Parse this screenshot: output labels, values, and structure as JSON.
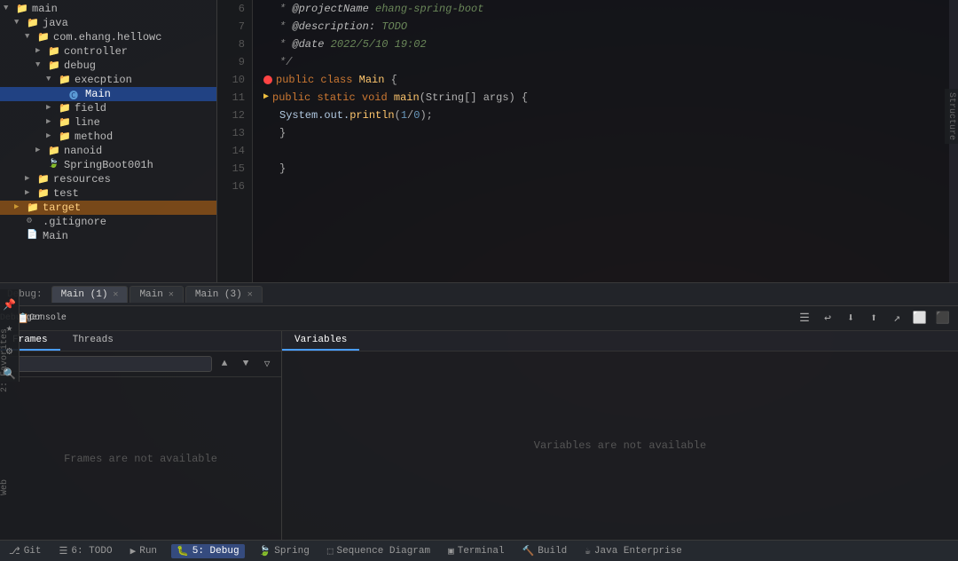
{
  "sidebar": {
    "tree": [
      {
        "id": "main",
        "label": "main",
        "level": 0,
        "type": "folder",
        "expanded": true,
        "icon": "▼"
      },
      {
        "id": "java",
        "label": "java",
        "level": 1,
        "type": "folder",
        "expanded": true,
        "icon": "▼"
      },
      {
        "id": "com.ehang.hellowc",
        "label": "com.ehang.hellowc",
        "level": 2,
        "type": "folder",
        "expanded": true,
        "icon": "▼"
      },
      {
        "id": "controller",
        "label": "controller",
        "level": 3,
        "type": "folder",
        "expanded": false,
        "icon": "▶"
      },
      {
        "id": "debug",
        "label": "debug",
        "level": 3,
        "type": "folder",
        "expanded": true,
        "icon": "▼"
      },
      {
        "id": "exception",
        "label": "execption",
        "level": 4,
        "type": "folder",
        "expanded": true,
        "icon": "▼"
      },
      {
        "id": "Main",
        "label": "Main",
        "level": 5,
        "type": "class",
        "selected": true,
        "icon": "🅒"
      },
      {
        "id": "field",
        "label": "field",
        "level": 4,
        "type": "folder",
        "expanded": false,
        "icon": "▶"
      },
      {
        "id": "line",
        "label": "line",
        "level": 4,
        "type": "folder",
        "expanded": false,
        "icon": "▶"
      },
      {
        "id": "method",
        "label": "method",
        "level": 4,
        "type": "folder",
        "expanded": false,
        "icon": "▶"
      },
      {
        "id": "nanoid",
        "label": "nanoid",
        "level": 3,
        "type": "folder",
        "expanded": false,
        "icon": "▶"
      },
      {
        "id": "SpringBoot001h",
        "label": "SpringBoot001h",
        "level": 3,
        "type": "class"
      },
      {
        "id": "resources",
        "label": "resources",
        "level": 2,
        "type": "folder",
        "expanded": false,
        "icon": "▶"
      },
      {
        "id": "test",
        "label": "test",
        "level": 2,
        "type": "folder",
        "expanded": false,
        "icon": "▶"
      },
      {
        "id": "target",
        "label": "target",
        "level": 1,
        "type": "folder",
        "expanded": false,
        "icon": "▶",
        "highlighted": true
      },
      {
        "id": "gitignore",
        "label": ".gitignore",
        "level": 1,
        "type": "file"
      },
      {
        "id": "pom",
        "label": "Main",
        "level": 1,
        "type": "file"
      }
    ]
  },
  "editor": {
    "lines": [
      {
        "num": 6,
        "tokens": [
          {
            "t": " * ",
            "c": "comment"
          },
          {
            "t": "@projectName ",
            "c": "annotation"
          },
          {
            "t": "ehang-spring-boot",
            "c": "annot-val"
          }
        ]
      },
      {
        "num": 7,
        "tokens": [
          {
            "t": " * ",
            "c": "comment"
          },
          {
            "t": "@description: ",
            "c": "annotation"
          },
          {
            "t": "TODO",
            "c": "annot-val"
          }
        ]
      },
      {
        "num": 8,
        "tokens": [
          {
            "t": " * ",
            "c": "comment"
          },
          {
            "t": "@date ",
            "c": "annotation"
          },
          {
            "t": "2022/5/10 19:02",
            "c": "annot-val"
          }
        ]
      },
      {
        "num": 9,
        "tokens": [
          {
            "t": " */",
            "c": "comment"
          }
        ]
      },
      {
        "num": 10,
        "tokens": [
          {
            "t": "public ",
            "c": "kw"
          },
          {
            "t": "class ",
            "c": "kw"
          },
          {
            "t": "Main ",
            "c": "class-name"
          },
          {
            "t": "{",
            "c": "punc"
          }
        ],
        "breakpoint": true
      },
      {
        "num": 11,
        "tokens": [
          {
            "t": "    public ",
            "c": "kw"
          },
          {
            "t": "static ",
            "c": "kw"
          },
          {
            "t": "void ",
            "c": "kw-void"
          },
          {
            "t": "main",
            "c": "method-name"
          },
          {
            "t": "(String[] args) {",
            "c": "param"
          }
        ],
        "arrow": true
      },
      {
        "num": 12,
        "tokens": [
          {
            "t": "        System.out.",
            "c": "sys-out"
          },
          {
            "t": "println",
            "c": "method-name"
          },
          {
            "t": "(",
            "c": "punc"
          },
          {
            "t": "1",
            "c": "number"
          },
          {
            "t": "/",
            "c": "punc"
          },
          {
            "t": "0",
            "c": "number"
          },
          {
            "t": ");",
            "c": "punc"
          }
        ]
      },
      {
        "num": 13,
        "tokens": [
          {
            "t": "    }",
            "c": "punc"
          }
        ]
      },
      {
        "num": 14,
        "tokens": []
      },
      {
        "num": 15,
        "tokens": [
          {
            "t": "}",
            "c": "punc"
          }
        ]
      },
      {
        "num": 16,
        "tokens": []
      }
    ]
  },
  "debug": {
    "label": "Debug:",
    "tabs": [
      {
        "label": "Main (1)",
        "active": true
      },
      {
        "label": "Main",
        "active": false
      },
      {
        "label": "Main (3)",
        "active": false
      }
    ],
    "toolbar": {
      "buttons": [
        "⚙",
        "📋",
        "☰",
        "↩",
        "⬇",
        "⬆",
        "↗",
        "⬜",
        "⬛"
      ]
    },
    "sections": {
      "frames_tab": "Frames",
      "threads_tab": "Threads",
      "variables_header": "Variables",
      "frames_empty": "Frames are not available",
      "variables_empty": "Variables are not available"
    }
  },
  "statusbar": {
    "items": [
      {
        "label": "Git",
        "icon": "⎇",
        "id": "git"
      },
      {
        "label": "6: TODO",
        "icon": "☰",
        "id": "todo"
      },
      {
        "label": "Run",
        "icon": "▶",
        "id": "run"
      },
      {
        "label": "5: Debug",
        "icon": "🐛",
        "id": "debug",
        "active": true
      },
      {
        "label": "Spring",
        "icon": "🍃",
        "id": "spring"
      },
      {
        "label": "Sequence Diagram",
        "icon": "⬚",
        "id": "seq"
      },
      {
        "label": "Terminal",
        "icon": "▣",
        "id": "terminal"
      },
      {
        "label": "Build",
        "icon": "🔨",
        "id": "build"
      },
      {
        "label": "Java Enterprise",
        "icon": "☕",
        "id": "java-ent"
      }
    ]
  },
  "labels": {
    "structure": "Structure",
    "favorites": "2: Favorites",
    "web": "Web"
  }
}
